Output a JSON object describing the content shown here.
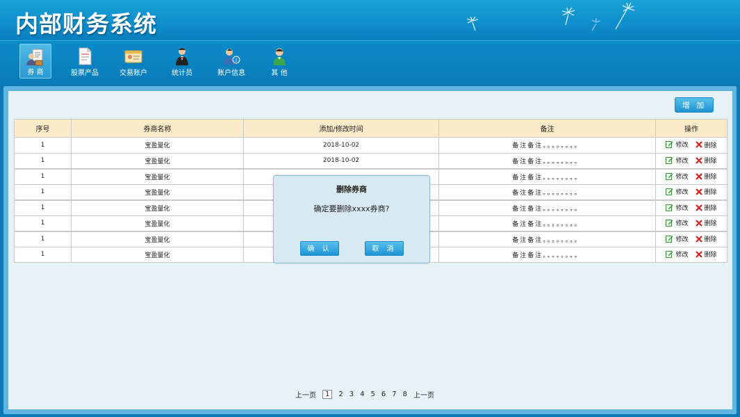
{
  "app": {
    "title": "内部财务系统"
  },
  "nav": {
    "items": [
      {
        "label": "券 商",
        "icon": "broker-icon",
        "active": true
      },
      {
        "label": "股票产品",
        "icon": "document-icon",
        "active": false
      },
      {
        "label": "交易账户",
        "icon": "id-card-icon",
        "active": false
      },
      {
        "label": "统计员",
        "icon": "waiter-person-icon",
        "active": false
      },
      {
        "label": "账户信息",
        "icon": "user-info-icon",
        "active": false
      },
      {
        "label": "其 他",
        "icon": "person-icon",
        "active": false
      }
    ]
  },
  "toolbar": {
    "add_label": "增 加"
  },
  "table": {
    "headers": [
      "序号",
      "券商名称",
      "添加/修改时间",
      "备注",
      "操作"
    ],
    "rows": [
      {
        "index": "1",
        "name": "宝盈量化",
        "time": "2018-10-02",
        "note": "备注备注。。。。。。。。"
      },
      {
        "index": "1",
        "name": "宝盈量化",
        "time": "2018-10-02",
        "note": "备注备注。。。。。。。。"
      },
      {
        "index": "1",
        "name": "宝盈量化",
        "time": "",
        "note": "备注备注。。。。。。。。"
      },
      {
        "index": "1",
        "name": "宝盈量化",
        "time": "",
        "note": "备注备注。。。。。。。。"
      },
      {
        "index": "1",
        "name": "宝盈量化",
        "time": "",
        "note": "备注备注。。。。。。。。"
      },
      {
        "index": "1",
        "name": "宝盈量化",
        "time": "",
        "note": "备注备注。。。。。。。。"
      },
      {
        "index": "1",
        "name": "宝盈量化",
        "time": "",
        "note": "备注备注。。。。。。。。"
      },
      {
        "index": "1",
        "name": "宝盈量化",
        "time": "",
        "note": "备注备注。。。。。。。。"
      }
    ],
    "edit_label": "修改",
    "delete_label": "删除"
  },
  "modal": {
    "title": "删除券商",
    "message": "确定要删除xxxx券商?",
    "confirm_label": "确 认",
    "cancel_label": "取 消"
  },
  "pagination": {
    "prev_label": "上一页",
    "pages": [
      "1",
      "2",
      "3",
      "4",
      "5",
      "6",
      "7",
      "8"
    ],
    "current": "1",
    "next_label": "上一页"
  },
  "colors": {
    "header_blue": "#0f8fcc",
    "table_header_bg": "#fbebc8",
    "button_blue": "#1e94d3",
    "edit_green": "#2e9a2e",
    "delete_red": "#d42020"
  }
}
